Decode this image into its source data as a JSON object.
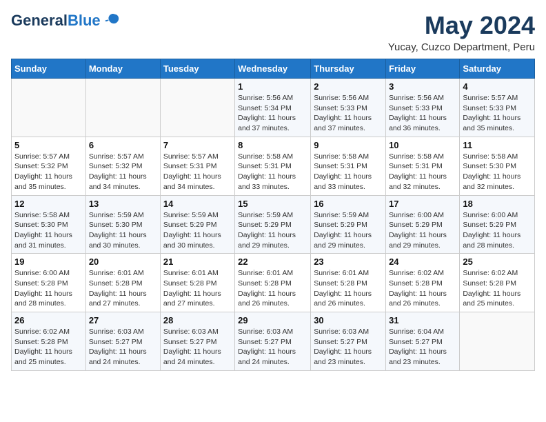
{
  "header": {
    "logo_line1": "General",
    "logo_line2": "Blue",
    "month": "May 2024",
    "location": "Yucay, Cuzco Department, Peru"
  },
  "days_of_week": [
    "Sunday",
    "Monday",
    "Tuesday",
    "Wednesday",
    "Thursday",
    "Friday",
    "Saturday"
  ],
  "weeks": [
    [
      {
        "day": "",
        "sunrise": "",
        "sunset": "",
        "daylight": ""
      },
      {
        "day": "",
        "sunrise": "",
        "sunset": "",
        "daylight": ""
      },
      {
        "day": "",
        "sunrise": "",
        "sunset": "",
        "daylight": ""
      },
      {
        "day": "1",
        "sunrise": "5:56 AM",
        "sunset": "5:34 PM",
        "daylight": "11 hours and 37 minutes."
      },
      {
        "day": "2",
        "sunrise": "5:56 AM",
        "sunset": "5:33 PM",
        "daylight": "11 hours and 37 minutes."
      },
      {
        "day": "3",
        "sunrise": "5:56 AM",
        "sunset": "5:33 PM",
        "daylight": "11 hours and 36 minutes."
      },
      {
        "day": "4",
        "sunrise": "5:57 AM",
        "sunset": "5:33 PM",
        "daylight": "11 hours and 35 minutes."
      }
    ],
    [
      {
        "day": "5",
        "sunrise": "5:57 AM",
        "sunset": "5:32 PM",
        "daylight": "11 hours and 35 minutes."
      },
      {
        "day": "6",
        "sunrise": "5:57 AM",
        "sunset": "5:32 PM",
        "daylight": "11 hours and 34 minutes."
      },
      {
        "day": "7",
        "sunrise": "5:57 AM",
        "sunset": "5:31 PM",
        "daylight": "11 hours and 34 minutes."
      },
      {
        "day": "8",
        "sunrise": "5:58 AM",
        "sunset": "5:31 PM",
        "daylight": "11 hours and 33 minutes."
      },
      {
        "day": "9",
        "sunrise": "5:58 AM",
        "sunset": "5:31 PM",
        "daylight": "11 hours and 33 minutes."
      },
      {
        "day": "10",
        "sunrise": "5:58 AM",
        "sunset": "5:31 PM",
        "daylight": "11 hours and 32 minutes."
      },
      {
        "day": "11",
        "sunrise": "5:58 AM",
        "sunset": "5:30 PM",
        "daylight": "11 hours and 32 minutes."
      }
    ],
    [
      {
        "day": "12",
        "sunrise": "5:58 AM",
        "sunset": "5:30 PM",
        "daylight": "11 hours and 31 minutes."
      },
      {
        "day": "13",
        "sunrise": "5:59 AM",
        "sunset": "5:30 PM",
        "daylight": "11 hours and 30 minutes."
      },
      {
        "day": "14",
        "sunrise": "5:59 AM",
        "sunset": "5:29 PM",
        "daylight": "11 hours and 30 minutes."
      },
      {
        "day": "15",
        "sunrise": "5:59 AM",
        "sunset": "5:29 PM",
        "daylight": "11 hours and 29 minutes."
      },
      {
        "day": "16",
        "sunrise": "5:59 AM",
        "sunset": "5:29 PM",
        "daylight": "11 hours and 29 minutes."
      },
      {
        "day": "17",
        "sunrise": "6:00 AM",
        "sunset": "5:29 PM",
        "daylight": "11 hours and 29 minutes."
      },
      {
        "day": "18",
        "sunrise": "6:00 AM",
        "sunset": "5:29 PM",
        "daylight": "11 hours and 28 minutes."
      }
    ],
    [
      {
        "day": "19",
        "sunrise": "6:00 AM",
        "sunset": "5:28 PM",
        "daylight": "11 hours and 28 minutes."
      },
      {
        "day": "20",
        "sunrise": "6:01 AM",
        "sunset": "5:28 PM",
        "daylight": "11 hours and 27 minutes."
      },
      {
        "day": "21",
        "sunrise": "6:01 AM",
        "sunset": "5:28 PM",
        "daylight": "11 hours and 27 minutes."
      },
      {
        "day": "22",
        "sunrise": "6:01 AM",
        "sunset": "5:28 PM",
        "daylight": "11 hours and 26 minutes."
      },
      {
        "day": "23",
        "sunrise": "6:01 AM",
        "sunset": "5:28 PM",
        "daylight": "11 hours and 26 minutes."
      },
      {
        "day": "24",
        "sunrise": "6:02 AM",
        "sunset": "5:28 PM",
        "daylight": "11 hours and 26 minutes."
      },
      {
        "day": "25",
        "sunrise": "6:02 AM",
        "sunset": "5:28 PM",
        "daylight": "11 hours and 25 minutes."
      }
    ],
    [
      {
        "day": "26",
        "sunrise": "6:02 AM",
        "sunset": "5:28 PM",
        "daylight": "11 hours and 25 minutes."
      },
      {
        "day": "27",
        "sunrise": "6:03 AM",
        "sunset": "5:27 PM",
        "daylight": "11 hours and 24 minutes."
      },
      {
        "day": "28",
        "sunrise": "6:03 AM",
        "sunset": "5:27 PM",
        "daylight": "11 hours and 24 minutes."
      },
      {
        "day": "29",
        "sunrise": "6:03 AM",
        "sunset": "5:27 PM",
        "daylight": "11 hours and 24 minutes."
      },
      {
        "day": "30",
        "sunrise": "6:03 AM",
        "sunset": "5:27 PM",
        "daylight": "11 hours and 23 minutes."
      },
      {
        "day": "31",
        "sunrise": "6:04 AM",
        "sunset": "5:27 PM",
        "daylight": "11 hours and 23 minutes."
      },
      {
        "day": "",
        "sunrise": "",
        "sunset": "",
        "daylight": ""
      }
    ]
  ]
}
